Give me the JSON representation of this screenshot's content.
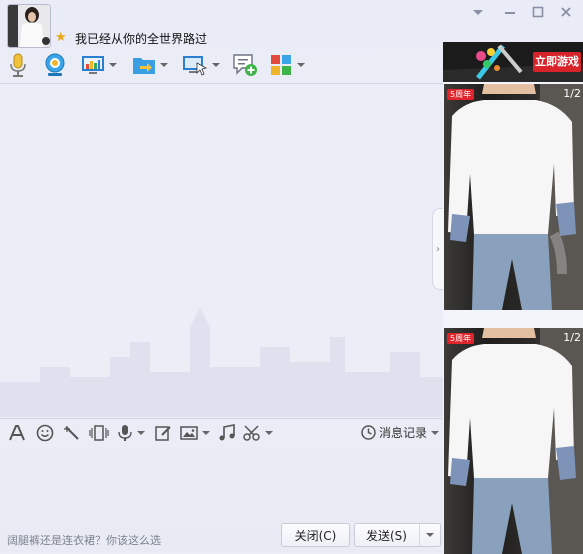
{
  "header": {
    "contact_name": "我已经从你的全世界路过",
    "window_controls": [
      "chevron-down-icon",
      "minimize-icon",
      "maximize-icon",
      "close-icon"
    ]
  },
  "toolbar": {
    "items": [
      {
        "icon": "microphone-icon",
        "has_menu": false
      },
      {
        "icon": "webcam-icon",
        "has_menu": false
      },
      {
        "icon": "screen-share-icon",
        "has_menu": true
      },
      {
        "icon": "file-transfer-icon",
        "has_menu": true
      },
      {
        "icon": "remote-desktop-icon",
        "has_menu": true
      },
      {
        "icon": "chat-add-icon",
        "has_menu": false
      },
      {
        "icon": "apps-grid-icon",
        "has_menu": true
      }
    ]
  },
  "input_toolbar": {
    "history_label": "消息记录"
  },
  "input": {
    "hint": "阔腿裤还是连衣裙？你该这么选"
  },
  "buttons": {
    "close_label": "关闭(C)",
    "send_label": "发送(S)"
  },
  "ad_panel": {
    "game_cta": "立即游戏",
    "photos": [
      {
        "page": "1/2",
        "badge": "5周年"
      },
      {
        "page": "1/2",
        "badge": "5周年"
      }
    ]
  },
  "colors": {
    "accent_blue": "#1d8fe0",
    "play_red": "#d9232a"
  }
}
